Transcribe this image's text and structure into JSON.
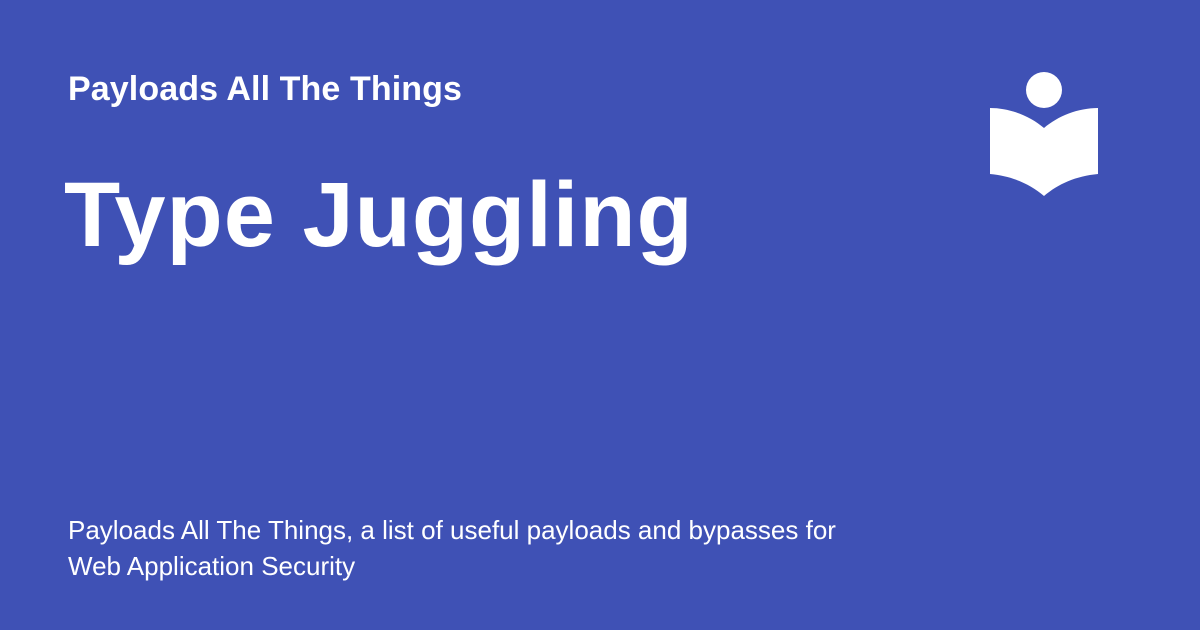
{
  "card": {
    "site_name": "Payloads All The Things",
    "title": "Type Juggling",
    "description_line1": "Payloads All The Things, a list of useful payloads and bypasses for",
    "description_line2": "Web Application Security",
    "background_color": "#3f51b5",
    "text_color": "#ffffff",
    "logo_icon": "reader-book-icon"
  }
}
